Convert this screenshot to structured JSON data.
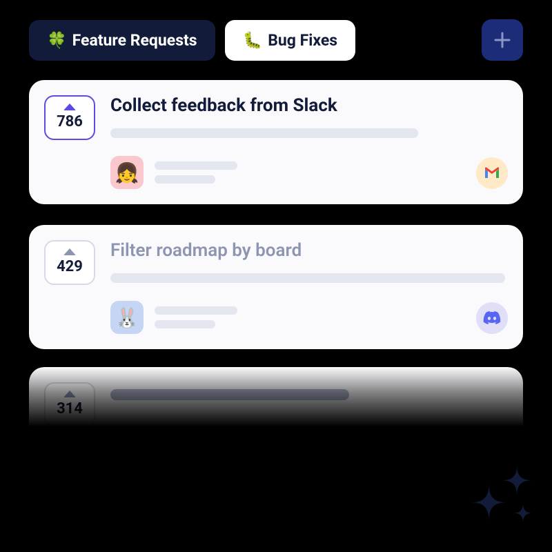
{
  "tabs": {
    "feature": {
      "emoji": "🍀",
      "label": "Feature Requests"
    },
    "bugs": {
      "emoji": "🐛",
      "label": "Bug Fixes"
    }
  },
  "card1": {
    "votes": "786",
    "title": "Collect feedback from Slack",
    "avatar_emoji": "👧",
    "source": "gmail"
  },
  "card2": {
    "votes": "429",
    "title": "Filter roadmap by board",
    "avatar_emoji": "🐰",
    "source": "discord"
  },
  "card3": {
    "votes": "314"
  }
}
